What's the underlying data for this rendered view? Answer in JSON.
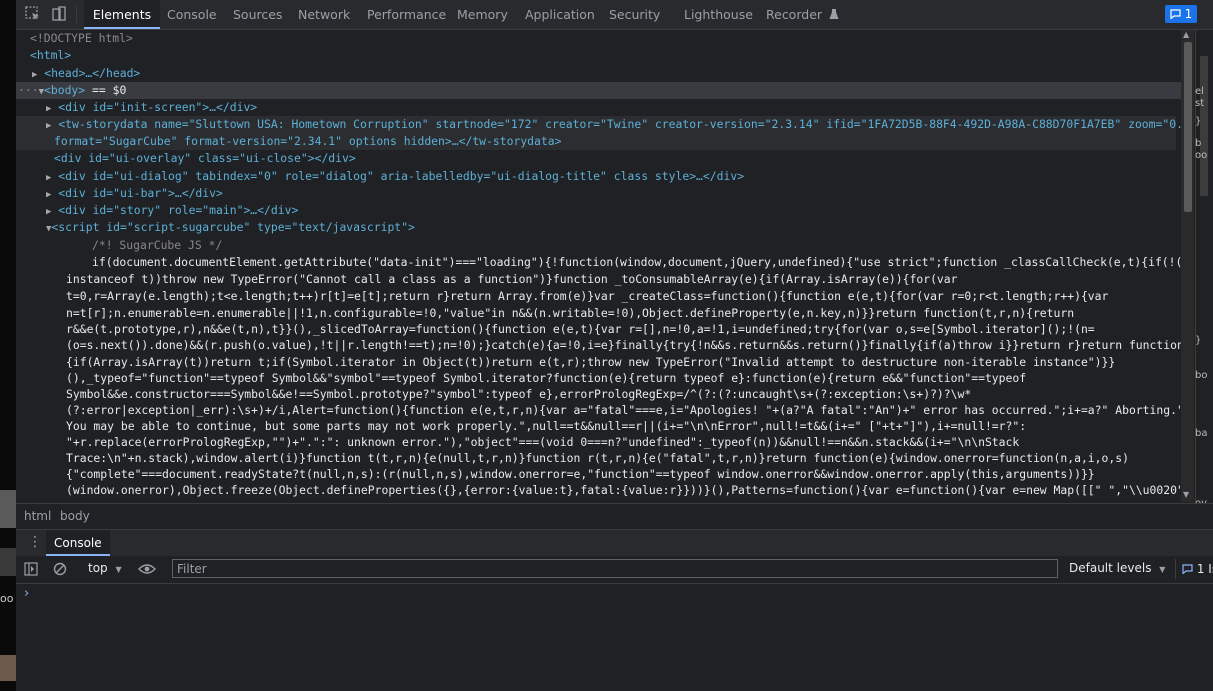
{
  "tabs": [
    "Elements",
    "Console",
    "Sources",
    "Network",
    "Performance",
    "Memory",
    "Application",
    "Security",
    "Lighthouse",
    "Recorder"
  ],
  "active_tab": "Elements",
  "issues_badge": "1",
  "dom": {
    "l1": "<!DOCTYPE html>",
    "l2": "<html>",
    "head": "<head>…</head>",
    "body_open": "<body>",
    "body_eq": " == $0",
    "init_screen": "<div id=\"init-screen\">…</div>",
    "storydata_a1": "<tw-storydata name=\"Sluttown USA: Hometown Corruption\" startnode=\"172\" creator=\"Twine\" creator-version=\"2.3.14\" ifid=\"1FA72D5B-88F4-492D-A98A-C88D70F1A7EB\" zoom=\"0.25\"",
    "storydata_a2": "format=\"SugarCube\" format-version=\"2.34.1\" options hidden>…</tw-storydata>",
    "ui_overlay": "<div id=\"ui-overlay\" class=\"ui-close\"></div>",
    "ui_dialog": "<div id=\"ui-dialog\" tabindex=\"0\" role=\"dialog\" aria-labelledby=\"ui-dialog-title\" class style>…</div>",
    "ui_bar": "<div id=\"ui-bar\">…</div>",
    "story": "<div id=\"story\" role=\"main\">…</div>",
    "script": "<script id=\"script-sugarcube\" type=\"text/javascript\">",
    "comment": "/*! SugarCube JS */",
    "js": [
      "if(document.documentElement.getAttribute(\"data-init\")===\"loading\"){!function(window,document,jQuery,undefined){\"use strict\";function _classCallCheck(e,t){if(!(e",
      "instanceof t))throw new TypeError(\"Cannot call a class as a function\")}function _toConsumableArray(e){if(Array.isArray(e)){for(var",
      "t=0,r=Array(e.length);t<e.length;t++)r[t]=e[t];return r}return Array.from(e)}var _createClass=function(){function e(e,t){for(var r=0;r<t.length;r++){var",
      "n=t[r];n.enumerable=n.enumerable||!1,n.configurable=!0,\"value\"in n&&(n.writable=!0),Object.defineProperty(e,n.key,n)}}return function(t,r,n){return",
      "r&&e(t.prototype,r),n&&e(t,n),t}}(),_slicedToArray=function(){function e(e,t){var r=[],n=!0,a=!1,i=undefined;try{for(var o,s=e[Symbol.iterator]();!(n=",
      "(o=s.next()).done)&&(r.push(o.value),!t||r.length!==t);n=!0);}catch(e){a=!0,i=e}finally{try{!n&&s.return&&s.return()}finally{if(a)throw i}}return r}return function(t,r)",
      "{if(Array.isArray(t))return t;if(Symbol.iterator in Object(t))return e(t,r);throw new TypeError(\"Invalid attempt to destructure non-iterable instance\")}}",
      "(),_typeof=\"function\"==typeof Symbol&&\"symbol\"==typeof Symbol.iterator?function(e){return typeof e}:function(e){return e&&\"function\"==typeof",
      "Symbol&&e.constructor===Symbol&&e!==Symbol.prototype?\"symbol\":typeof e},errorPrologRegExp=/^(?:(?:uncaught\\s+(?:exception:\\s+)?)?\\w*",
      "(?:error|exception|_err):\\s+)+/i,Alert=function(){function e(e,t,r,n){var a=\"fatal\"===e,i=\"Apologies! \"+(a?\"A fatal\":\"An\")+\" error has occurred.\";i+=a?\" Aborting.\":\"",
      "You may be able to continue, but some parts may not work properly.\",null==t&&null==r||(i+=\"\\n\\nError\",null!=t&&(i+=\" [\"+t+\"]\"),i+=null!=r?\":",
      "\"+r.replace(errorPrologRegExp,\"\")+\".\":\": unknown error.\"),\"object\"===(void 0===n?\"undefined\":_typeof(n))&&null!==n&&n.stack&&(i+=\"\\n\\nStack",
      "Trace:\\n\"+n.stack),window.alert(i)}function t(t,r,n){e(null,t,r,n)}function r(t,r,n){e(\"fatal\",t,r,n)}return function(e){window.onerror=function(n,a,i,o,s)",
      "{\"complete\"===document.readyState?t(null,n,s):(r(null,n,s),window.onerror=e,\"function\"==typeof window.onerror&&window.onerror.apply(this,arguments))}}",
      "(window.onerror),Object.freeze(Object.defineProperties({},{error:{value:t},fatal:{value:r}}))}(),Patterns=function(){var e=function(){var e=new Map([[\" \",\"\\\\u0020\"],"
    ]
  },
  "breadcrumbs": [
    "html",
    "body"
  ],
  "drawer_tab": "Console",
  "console": {
    "context": "top",
    "filter_placeholder": "Filter",
    "levels": "Default levels",
    "issues": "1 Issue"
  },
  "right_pane_snips": [
    "el",
    "st",
    "}",
    "b",
    "oo",
    "}",
    "bo",
    "ba",
    "ov"
  ],
  "left_strip_snips": [
    "oo"
  ],
  "colors": {
    "accent": "#8ab4f8",
    "tag": "#5db0d7",
    "attr_value": "#f29766",
    "background": "#202124"
  }
}
